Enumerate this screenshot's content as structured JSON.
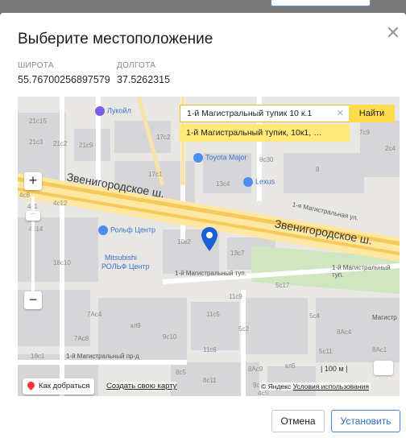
{
  "dialog": {
    "title": "Выберите местоположение",
    "close_icon": "close-icon",
    "latitude_label": "широта",
    "longitude_label": "долгота",
    "latitude_value": "55.76700256897579",
    "longitude_value": "37.5262315",
    "cancel_label": "Отмена",
    "confirm_label": "Установить"
  },
  "map": {
    "search_value": "1-й Магистральный тупик 10 к.1",
    "search_button": "Найти",
    "suggestion": "1-й Магистральный тупик, 10к1, …",
    "zoom_in": "+",
    "zoom_out": "−",
    "route_button": "Как добраться",
    "create_map_link": "Создать свою карту",
    "scale_label": "100 м",
    "copyright_text": "© Яндекс",
    "terms_link": "Условия использования",
    "road_names": [
      "Звенигородское ш.",
      "Звенигородское ш.",
      "1-я Магистральная ул.",
      "1-й Магистральный туп.",
      "1-й Магистральный туп.",
      "1-й Магистральный пр-д",
      "Магистр"
    ],
    "pois": [
      "Лукойл",
      "Toyota Major",
      "Lexus",
      "Рольф Центр",
      "Mitsubishi",
      "РОЛЬФ Центр"
    ],
    "house_numbers": [
      "21с15",
      "21с3",
      "21с2",
      "21с9",
      "17с2",
      "17с1",
      "13с4",
      "8с30",
      "8",
      "4с1",
      "4с12",
      "4с14",
      "10к2",
      "13с7",
      "18с10",
      "5с17",
      "11с9",
      "5с4",
      "7Ac4",
      "кл9",
      "11с5",
      "9с10",
      "5с2",
      "8Ac4",
      "7Ac8",
      "11с6",
      "5с11",
      "18с1",
      "8с5",
      "8с11",
      "8Ac9",
      "кл5",
      "4с8",
      "7с9",
      "2с4",
      "8Ac1",
      "9с5",
      "4с5"
    ],
    "colors": {
      "marker": "#1a60d4",
      "route_pin": "#ff3333",
      "search_button": "#ffdb4d",
      "suggestion": "#ffe979"
    }
  },
  "background": {
    "button": ""
  }
}
